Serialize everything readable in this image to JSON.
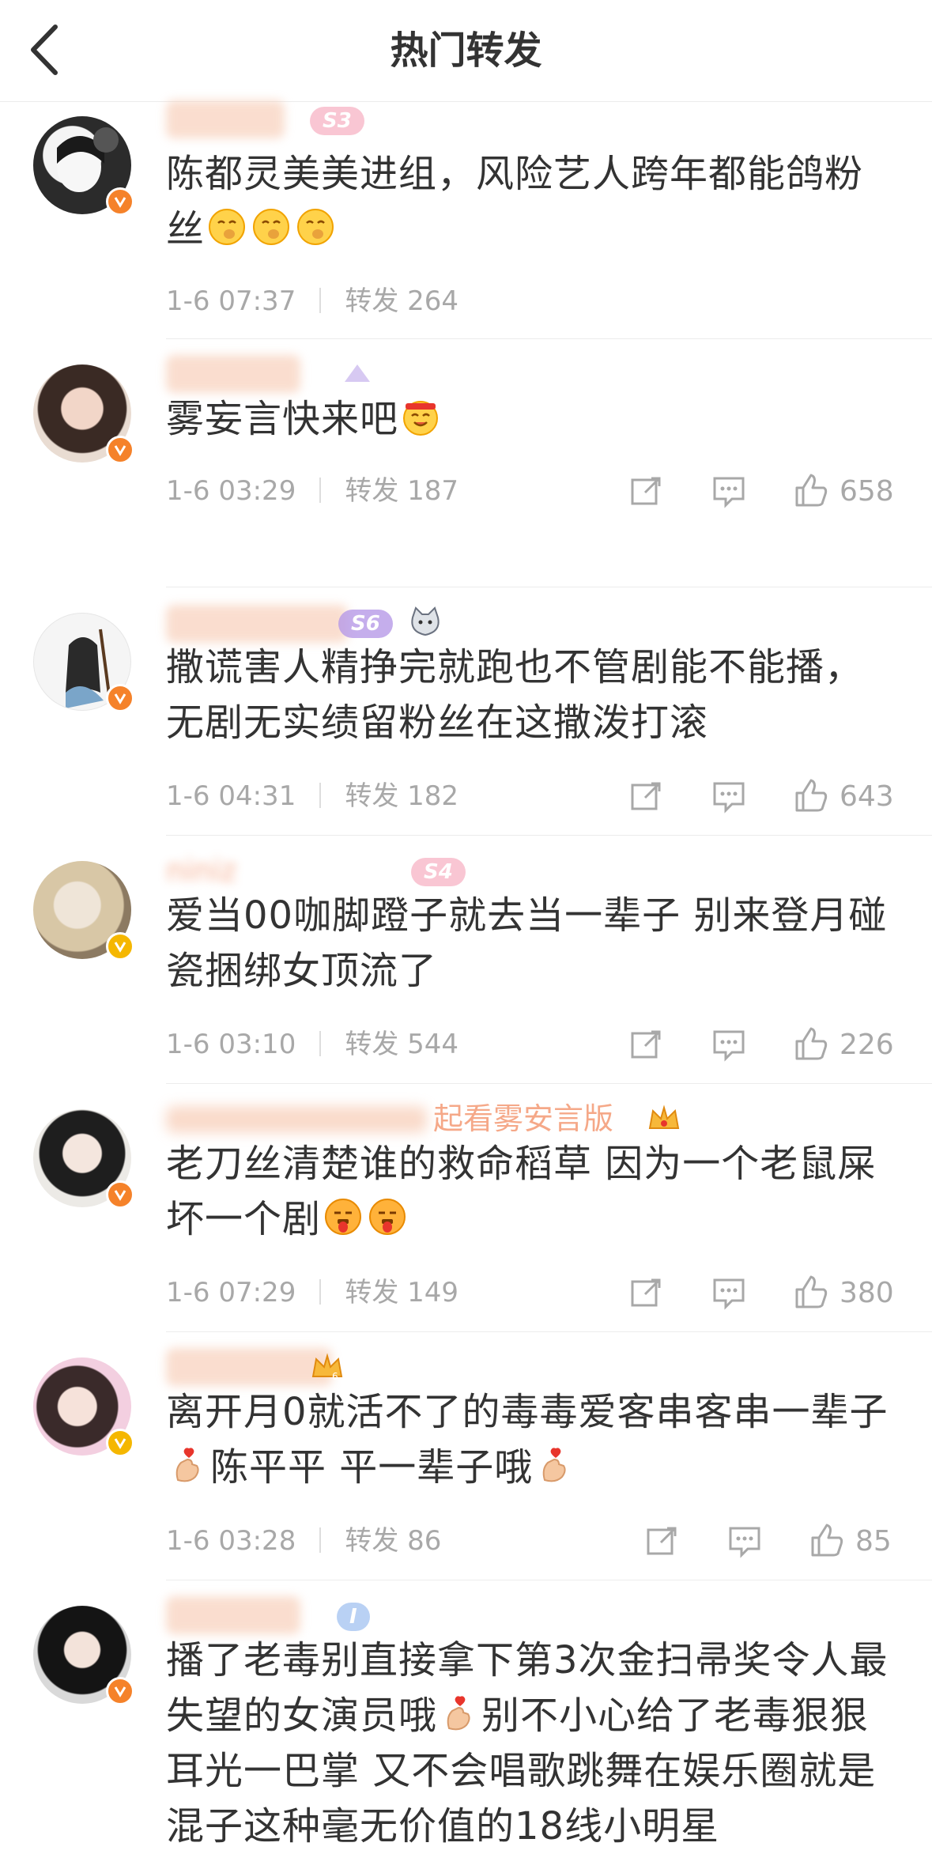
{
  "nav": {
    "title": "热门转发"
  },
  "posts": [
    {
      "username": "",
      "level": "S3",
      "content": "陈都灵美美进组，风险艺人跨年都能鸽粉丝",
      "time": "1-6 07:37",
      "repost": "转发 264",
      "likes": ""
    },
    {
      "username": "",
      "level": "",
      "content": "雾妄言快来吧",
      "time": "1-6 03:29",
      "repost": "转发 187",
      "likes": "658"
    },
    {
      "username": "",
      "level": "S6",
      "content": "撒谎害人精挣完就跑也不管剧能不能播，无剧无实绩留粉丝在这撒泼打滚",
      "time": "1-6 04:31",
      "repost": "转发 182",
      "likes": "643"
    },
    {
      "username": "niniz",
      "level": "S4",
      "content": "爱当00咖脚蹬子就去当一辈子 别来登月碰瓷捆绑女顶流了",
      "time": "1-6 03:10",
      "repost": "转发 544",
      "likes": "226"
    },
    {
      "username": "起看雾安言版",
      "level": "",
      "content_a": "老刀丝清楚谁的救命稻草 因为一个老鼠屎坏一个剧",
      "time": "1-6 07:29",
      "repost": "转发 149",
      "likes": "380"
    },
    {
      "username": "",
      "level": "",
      "content_a": "离开月0就活不了的毒毒爱客串客串一辈子",
      "content_b": "陈平平 平一辈子哦",
      "time": "1-6 03:28",
      "repost": "转发 86",
      "likes": "85"
    },
    {
      "username": "",
      "level": "I",
      "content_a": "播了老毒别直接拿下第3次金扫帚奖令人最失望的女演员哦",
      "content_b": "别不小心给了老毒狠狠耳光一巴掌 又不会唱歌跳舞在娱乐圈就是混子这种毫无价值的18线小明星",
      "time": "",
      "repost": "",
      "likes": ""
    }
  ],
  "colors": {
    "meta_gray": "#a8a8a8",
    "badge_orange": "#f5822a",
    "badge_yellow": "#f5b700",
    "username_orange": "#f0703a"
  },
  "icons": [
    "chevron-left-icon",
    "share-icon",
    "comment-icon",
    "like-icon",
    "verified-badge-icon"
  ]
}
